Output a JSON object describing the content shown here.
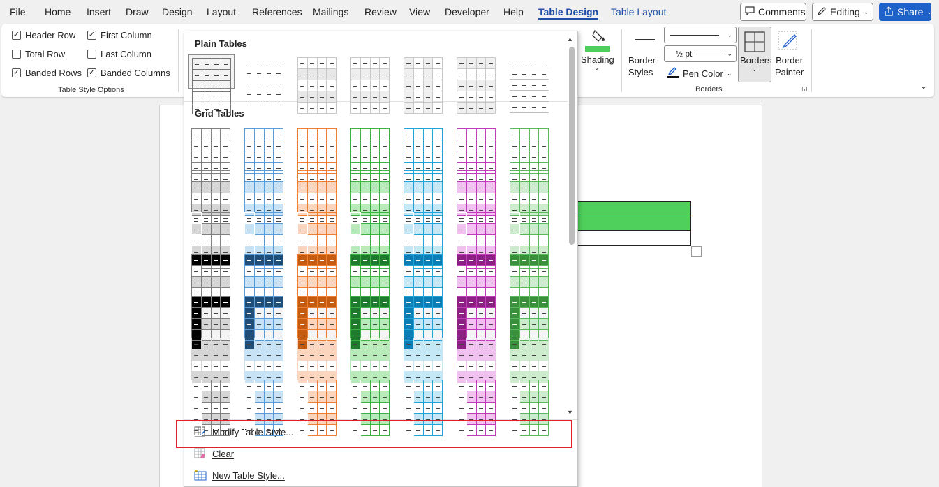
{
  "menubar": {
    "tabs": [
      "File",
      "Home",
      "Insert",
      "Draw",
      "Design",
      "Layout",
      "References",
      "Mailings",
      "Review",
      "View",
      "Developer",
      "Help",
      "Table Design",
      "Table Layout"
    ],
    "active_tab": "Table Design",
    "comments_label": "Comments",
    "editing_label": "Editing",
    "share_label": "Share"
  },
  "ribbon": {
    "style_options": {
      "header_row": "Header Row",
      "total_row": "Total Row",
      "banded_rows": "Banded Rows",
      "first_column": "First Column",
      "last_column": "Last Column",
      "banded_columns": "Banded Columns",
      "group_label": "Table Style Options"
    },
    "shading_label": "Shading",
    "border_styles_label": "Border\nStyles",
    "border_weight": "½ pt",
    "pen_color_label": "Pen Color",
    "borders_label": "Borders",
    "border_painter_label": "Border\nPainter",
    "borders_group_label": "Borders"
  },
  "gallery": {
    "plain_title": "Plain Tables",
    "grid_title": "Grid Tables",
    "colors": [
      "#7f7f7f",
      "#5b9bd5",
      "#ed7d31",
      "#3cb043",
      "#1fa2d6",
      "#c03bb8",
      "#5cb85c"
    ],
    "dark_colors": [
      "#000000",
      "#1f4e79",
      "#c55a11",
      "#1e7a2c",
      "#0b7fb5",
      "#8b1f84",
      "#3a8f3a"
    ],
    "light_colors": [
      "#d6d6d6",
      "#c7e2f5",
      "#fbd5bd",
      "#b9eab9",
      "#c5e8f7",
      "#f1c2ef",
      "#cdeccd"
    ],
    "menu": {
      "modify": "Modify Table Style...",
      "clear": "Clear",
      "new": "New Table Style..."
    }
  }
}
